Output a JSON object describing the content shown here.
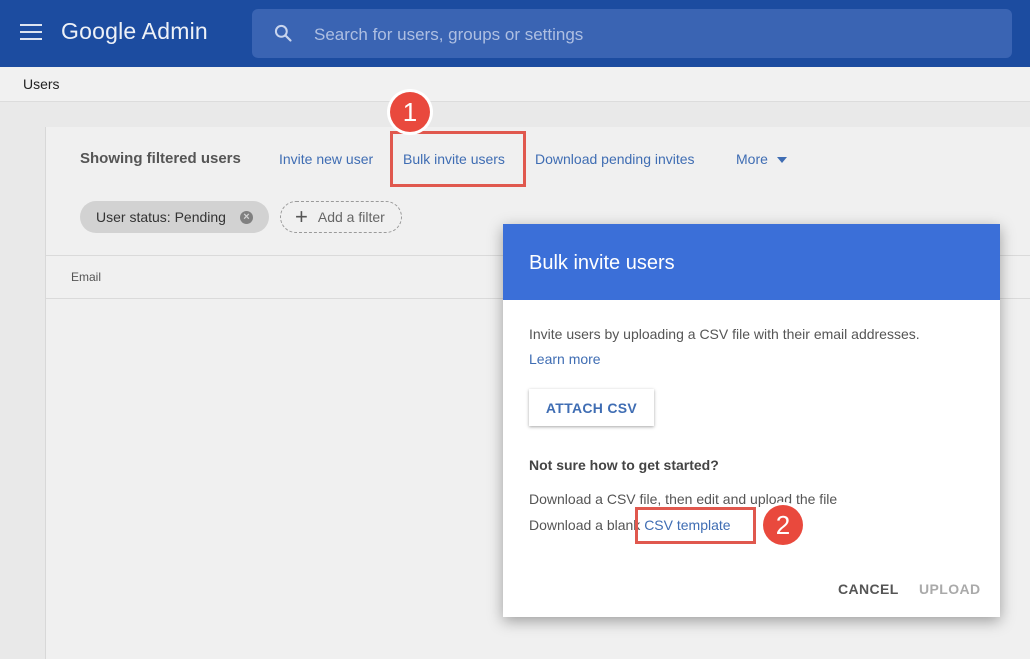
{
  "header": {
    "app_title": "Google Admin",
    "search_placeholder": "Search for users, groups or settings"
  },
  "breadcrumb": {
    "label": "Users"
  },
  "toolbar": {
    "title": "Showing filtered users",
    "invite_new_user": "Invite new user",
    "bulk_invite_users": "Bulk invite users",
    "download_pending_invites": "Download pending invites",
    "more": "More"
  },
  "filters": {
    "active_chip": "User status: Pending",
    "add_filter": "Add a filter"
  },
  "table": {
    "columns": [
      "Email"
    ]
  },
  "annotations": {
    "step1": "1",
    "step2": "2"
  },
  "dialog": {
    "title": "Bulk invite users",
    "description": "Invite users by uploading a CSV file with their email addresses.",
    "learn_more": "Learn more",
    "attach_button": "ATTACH CSV",
    "help_heading": "Not sure how to get started?",
    "help_line1": "Download a CSV file, then edit and upload the file",
    "help_line2_prefix": "Download a blank",
    "csv_template_link": "CSV template",
    "cancel": "CANCEL",
    "upload": "UPLOAD"
  },
  "colors": {
    "topbar": "#1c4ca0",
    "dialog_header": "#3b6fd8",
    "link": "#3f6db3",
    "annotation_red": "#e9493d"
  },
  "icons": [
    "menu-icon",
    "search-icon",
    "close-icon",
    "plus-icon",
    "chevron-down-icon"
  ]
}
